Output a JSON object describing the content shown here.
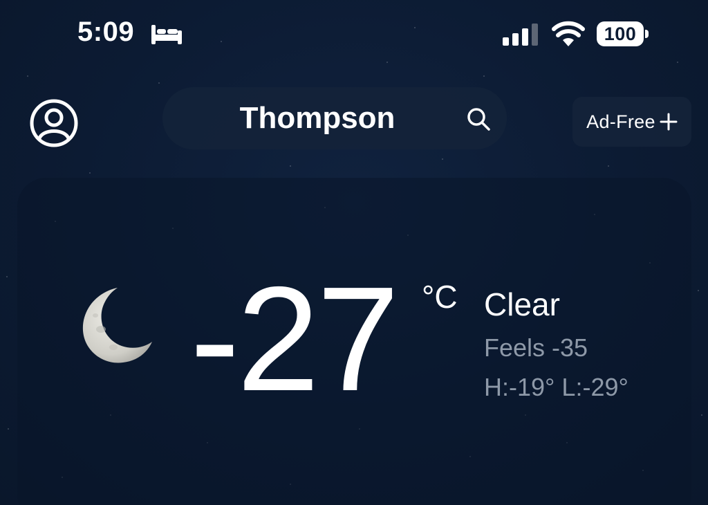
{
  "status_bar": {
    "time": "5:09",
    "focus_icon": "bed-icon",
    "signal_icon": "cellular-signal-icon",
    "wifi_icon": "wifi-icon",
    "battery_level": "100"
  },
  "header": {
    "profile_icon": "person-circle-icon",
    "location": "Thompson",
    "search_icon": "search-icon",
    "ad_free_label": "Ad-Free",
    "ad_free_icon": "plus-icon"
  },
  "current": {
    "condition_icon": "moon-icon",
    "temperature": "-27",
    "unit": "°C",
    "condition": "Clear",
    "feels_like": "Feels -35",
    "high_low": "H:-19° L:-29°"
  },
  "colors": {
    "background": "#0c1b33",
    "card": "#09162a",
    "text_primary": "#ffffff",
    "text_secondary": "#8e99a8"
  }
}
